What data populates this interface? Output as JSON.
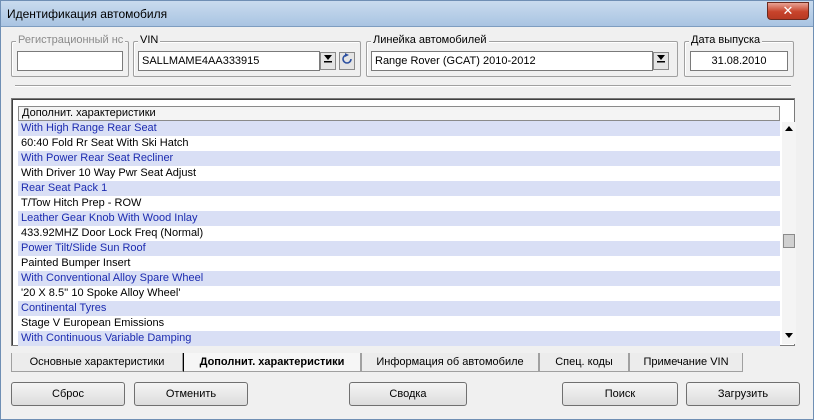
{
  "window": {
    "title": "Идентификация автомобиля",
    "close_label": "✕"
  },
  "fields": {
    "reg": {
      "label": "Регистрационный нс",
      "value": ""
    },
    "vin": {
      "label": "VIN",
      "value": "SALLMAME4AA333915"
    },
    "model_line": {
      "label": "Линейка автомобилей",
      "value": "Range Rover (GCAT) 2010-2012"
    },
    "release_date": {
      "label": "Дата выпуска",
      "value": "31.08.2010"
    }
  },
  "icons": {
    "combo_arrow": "dropdown-arrow-icon",
    "refresh": "refresh-icon"
  },
  "grid": {
    "header": "Дополнит. характеристики",
    "rows": [
      "With High Range Rear Seat",
      "60:40 Fold Rr Seat With Ski Hatch",
      "With Power Rear Seat Recliner",
      "With Driver 10 Way Pwr Seat Adjust",
      "Rear Seat Pack 1",
      "T/Tow Hitch Prep - ROW",
      "Leather Gear Knob With Wood Inlay",
      "433.92MHZ Door Lock Freq (Normal)",
      "Power Tilt/Slide Sun Roof",
      "Painted Bumper Insert",
      "With Conventional Alloy Spare Wheel",
      "'20 X 8.5'' 10 Spoke Alloy Wheel'",
      "Continental Tyres",
      "Stage V European Emissions",
      "With Continuous Variable Damping"
    ]
  },
  "tabs": [
    "Основные характеристики",
    "Дополнит. характеристики",
    "Информация об автомобиле",
    "Спец. коды",
    "Примечание VIN"
  ],
  "active_tab": "Дополнит. характеристики",
  "buttons": {
    "reset": "Сброс",
    "cancel": "Отменить",
    "summary": "Сводка",
    "search": "Поиск",
    "load": "Загрузить"
  },
  "colors": {
    "odd_row_bg": "#d9dff5",
    "odd_row_text": "#1c2bb0"
  }
}
